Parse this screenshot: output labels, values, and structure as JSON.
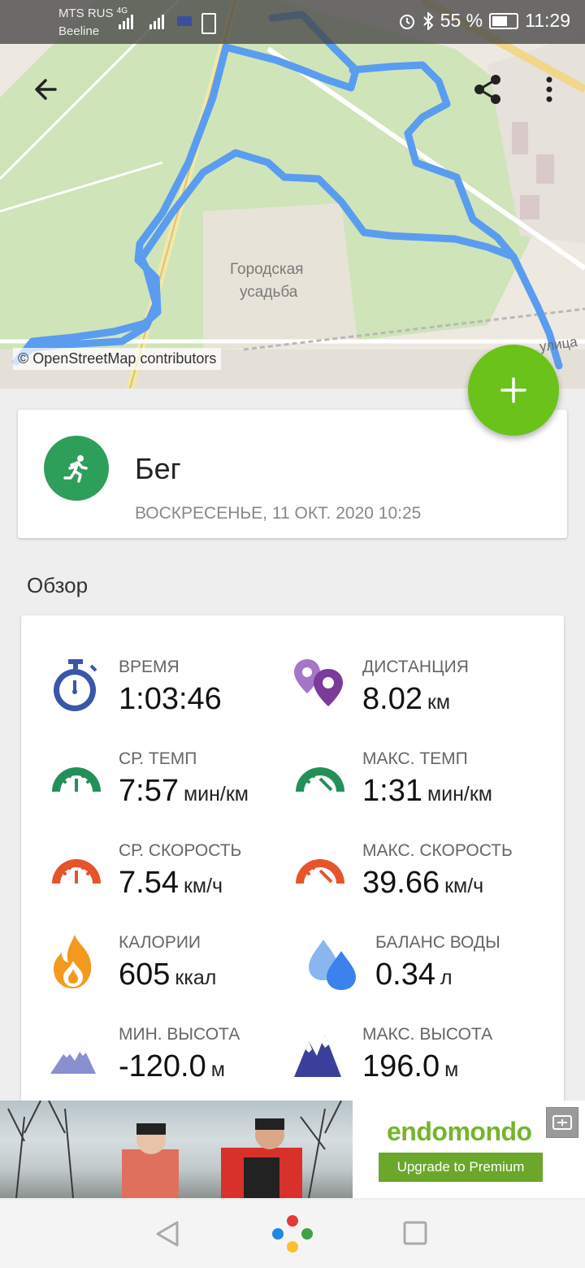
{
  "status_bar": {
    "carrier1": "MTS RUS",
    "carrier1_net": "4G",
    "carrier2": "Beeline",
    "battery": "55 %",
    "time": "11:29"
  },
  "map": {
    "label": "Городская\nусадьба",
    "label_line1": "Городская",
    "label_line2": "усадьба",
    "street_fragment": "улица",
    "attribution": "© OpenStreetMap contributors",
    "route_color": "#5a9cf0"
  },
  "toolbar": {
    "back_icon": "arrow-back-icon",
    "share_icon": "share-icon",
    "more_icon": "more-vert-icon"
  },
  "fab": {
    "icon": "plus-icon",
    "color": "#6ac21b"
  },
  "workout": {
    "sport": "Бег",
    "date": "ВОСКРЕСЕНЬЕ, 11 ОКТ. 2020 10:25",
    "icon": "running-person-icon",
    "icon_bg": "#2e9e5b"
  },
  "overview": {
    "title": "Обзор",
    "stats": [
      {
        "label": "ВРЕМЯ",
        "value": "1:03:46",
        "unit": "",
        "icon": "stopwatch-icon"
      },
      {
        "label": "ДИСТАНЦИЯ",
        "value": "8.02",
        "unit": "км",
        "icon": "map-pins-icon"
      },
      {
        "label": "СР. ТЕМП",
        "value": "7:57",
        "unit": "мин/км",
        "icon": "speedometer-green-icon"
      },
      {
        "label": "МАКС. ТЕМП",
        "value": "1:31",
        "unit": "мин/км",
        "icon": "speedometer-green-max-icon"
      },
      {
        "label": "СР. СКОРОСТЬ",
        "value": "7.54",
        "unit": "км/ч",
        "icon": "speedometer-red-icon"
      },
      {
        "label": "МАКС. СКОРОСТЬ",
        "value": "39.66",
        "unit": "км/ч",
        "icon": "speedometer-red-max-icon"
      },
      {
        "label": "КАЛОРИИ",
        "value": "605",
        "unit": "ккал",
        "icon": "flame-icon"
      },
      {
        "label": "БАЛАНС ВОДЫ",
        "value": "0.34",
        "unit": "л",
        "icon": "water-drops-icon"
      },
      {
        "label": "МИН. ВЫСОТА",
        "value": "-120.0",
        "unit": "м",
        "icon": "mountains-light-icon"
      },
      {
        "label": "МАКС. ВЫСОТА",
        "value": "196.0",
        "unit": "м",
        "icon": "mountains-dark-icon"
      }
    ]
  },
  "ad": {
    "brand": "endomondo",
    "cta": "Upgrade to Premium"
  },
  "nav_bar": {
    "back_icon": "nav-back-triangle-icon",
    "home_icon": "google-assistant-dots-icon",
    "recents_icon": "nav-recents-square-icon"
  }
}
